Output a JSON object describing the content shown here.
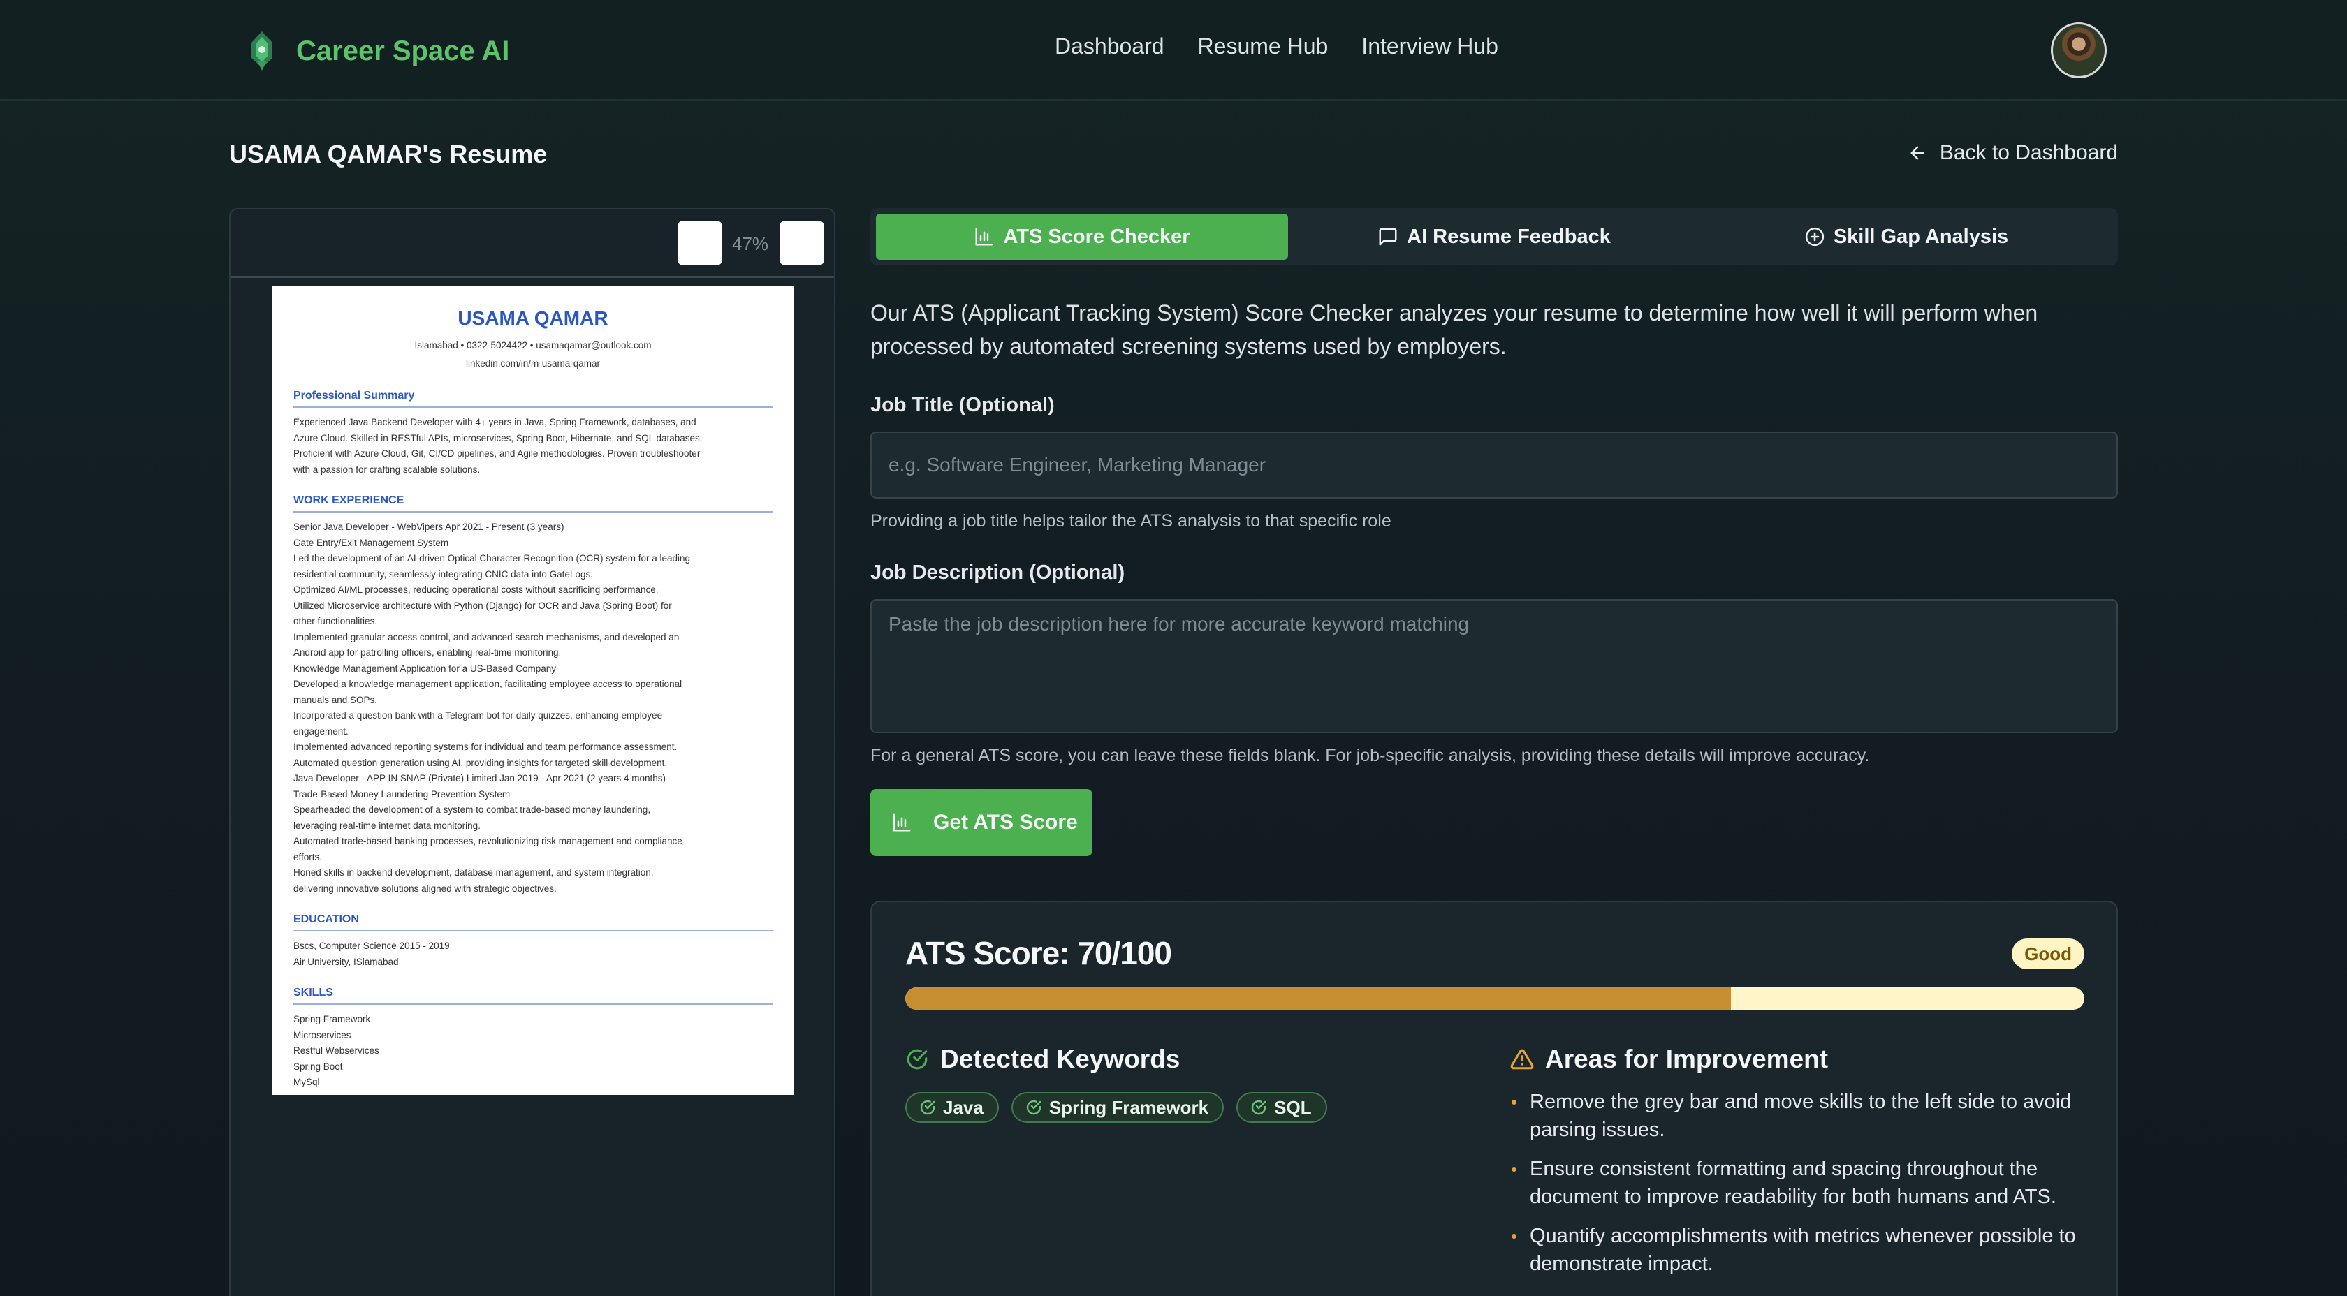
{
  "header": {
    "brand_name": "Career Space AI",
    "nav": [
      "Dashboard",
      "Resume Hub",
      "Interview Hub"
    ]
  },
  "page": {
    "title": "USAMA QAMAR's Resume",
    "back_label": "Back to Dashboard"
  },
  "preview": {
    "zoom_level": "47%",
    "resume": {
      "name": "USAMA QAMAR",
      "contact_line1": "Islamabad  •  0322-5024422  •  usamaqamar@outlook.com",
      "contact_line2": "linkedin.com/in/m-usama-qamar",
      "sections": [
        {
          "heading": "Professional Summary",
          "lines": [
            "Experienced Java Backend Developer with 4+ years in Java, Spring Framework, databases, and",
            "Azure Cloud. Skilled in RESTful APIs, microservices, Spring Boot, Hibernate, and SQL databases.",
            "Proficient with Azure Cloud, Git, CI/CD pipelines, and Agile methodologies. Proven troubleshooter",
            "with a passion for crafting scalable solutions."
          ]
        },
        {
          "heading": "WORK EXPERIENCE",
          "lines": [
            "Senior Java Developer - WebVipers Apr 2021 - Present (3 years)",
            "Gate Entry/Exit Management System",
            "Led the development of an AI-driven Optical Character Recognition (OCR) system for a leading",
            "residential community, seamlessly integrating CNIC data into GateLogs.",
            "Optimized AI/ML processes, reducing operational costs without sacrificing performance.",
            "Utilized Microservice architecture with Python (Django) for OCR and Java (Spring Boot) for",
            "other functionalities.",
            "Implemented granular access control, and advanced search mechanisms, and developed an",
            "Android app for patrolling officers, enabling real-time monitoring.",
            "Knowledge Management Application for a US-Based Company",
            "Developed a knowledge management application, facilitating employee access to operational",
            "manuals and SOPs.",
            "Incorporated a question bank with a Telegram bot for daily quizzes, enhancing employee",
            "engagement.",
            "Implemented advanced reporting systems for individual and team performance assessment.",
            "Automated question generation using AI, providing insights for targeted skill development.",
            "Java Developer - APP IN SNAP (Private) Limited Jan 2019 - Apr 2021 (2 years 4 months)",
            "Trade-Based Money Laundering Prevention System",
            "Spearheaded the development of a system to combat trade-based money laundering,",
            "leveraging real-time internet data monitoring.",
            "Automated trade-based banking processes, revolutionizing risk management and compliance",
            "efforts.",
            "Honed skills in backend development, database management, and system integration,",
            "delivering innovative solutions aligned with strategic objectives."
          ]
        },
        {
          "heading": "EDUCATION",
          "lines": [
            "Bscs, Computer Science 2015 - 2019",
            "Air University, ISlamabad"
          ]
        },
        {
          "heading": "SKILLS",
          "lines": [
            "Spring Framework",
            "Microservices",
            "Restful Webservices",
            "Spring Boot",
            "MySql"
          ]
        }
      ]
    }
  },
  "tabs": [
    {
      "label": "ATS Score Checker",
      "icon": "bar-chart-icon",
      "active": true
    },
    {
      "label": "AI Resume Feedback",
      "icon": "chat-icon",
      "active": false
    },
    {
      "label": "Skill Gap Analysis",
      "icon": "plus-circle-icon",
      "active": false
    }
  ],
  "ats": {
    "intro": "Our ATS (Applicant Tracking System) Score Checker analyzes your resume to determine how well it will perform when processed by automated screening systems used by employers.",
    "job_title_label": "Job Title (Optional)",
    "job_title_placeholder": "e.g. Software Engineer, Marketing Manager",
    "job_title_value": "",
    "job_title_hint": "Providing a job title helps tailor the ATS analysis to that specific role",
    "job_desc_label": "Job Description (Optional)",
    "job_desc_placeholder": "Paste the job description here for more accurate keyword matching",
    "job_desc_value": "",
    "general_hint": "For a general ATS score, you can leave these fields blank. For job-specific analysis, providing these details will improve accuracy.",
    "submit_label": "Get ATS Score"
  },
  "result": {
    "score_text": "ATS Score: 70/100",
    "score_value": 70,
    "score_max": 100,
    "rating": "Good",
    "keywords_heading": "Detected Keywords",
    "keywords": [
      "Java",
      "Spring Framework",
      "SQL"
    ],
    "improvement_heading": "Areas for Improvement",
    "improvements": [
      "Remove the grey bar and move skills to the left side to avoid parsing issues.",
      "Ensure consistent formatting and spacing throughout the document to improve readability for both humans and ATS.",
      "Quantify accomplishments with metrics whenever possible to demonstrate impact."
    ]
  },
  "colors": {
    "accent_green": "#4caf50",
    "brand_green": "#5cc36b",
    "progress_fill": "#c78f32",
    "progress_track": "#fff5c9",
    "warning_amber": "#e3a52b"
  }
}
